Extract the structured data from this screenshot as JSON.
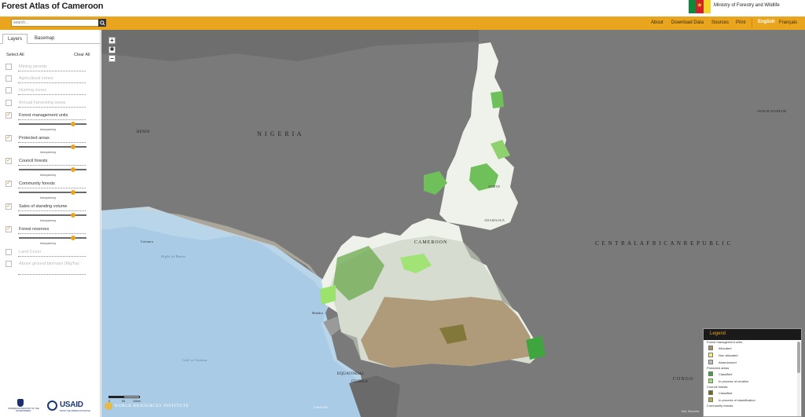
{
  "header": {
    "app_title": "Forest Atlas of Cameroon",
    "ministry": "Ministry of Forestry and Wildlife"
  },
  "navbar": {
    "search_placeholder": "search...",
    "links": [
      "About",
      "Download Data",
      "Sources",
      "Print"
    ],
    "lang_active": "English",
    "lang_other": "Français"
  },
  "sidebar": {
    "tabs": [
      "Layers",
      "Basemap"
    ],
    "select_all": "Select All",
    "clear_all": "Clear All",
    "transparency_label": "transparency",
    "layers": [
      {
        "label": "Mining permits",
        "checked": false
      },
      {
        "label": "Agricultural zones",
        "checked": false
      },
      {
        "label": "Hunting zones",
        "checked": false
      },
      {
        "label": "Annual harvesting areas",
        "checked": false
      },
      {
        "label": "Forest management units",
        "checked": true,
        "opacity": 0.82
      },
      {
        "label": "Protected areas",
        "checked": true,
        "opacity": 0.82
      },
      {
        "label": "Council forests",
        "checked": true,
        "opacity": 0.82
      },
      {
        "label": "Community forests",
        "checked": true,
        "opacity": 0.82
      },
      {
        "label": "Sales of standing volume",
        "checked": true,
        "opacity": 0.82
      },
      {
        "label": "Forest reserves",
        "checked": true,
        "opacity": 0.82
      },
      {
        "label": "Land Cover",
        "checked": false
      },
      {
        "label": "Above ground biomass (Mg/ha)",
        "checked": false
      }
    ],
    "logos": {
      "norway": "NORWEGIAN MINISTRY OF THE ENVIRONMENT",
      "usaid": "USAID",
      "usaid_sub": "FROM THE AMERICAN PEOPLE"
    }
  },
  "map": {
    "zoom_in": "+",
    "zoom_out": "−",
    "wri": "WORLD RESOURCES INSTITUTE",
    "scale_labels": [
      "0",
      "50",
      "100mi"
    ],
    "attribution": "Esri, DeLorme",
    "labels": [
      {
        "text": "N I G E R I A",
        "size": 8,
        "color": "#222"
      },
      {
        "text": "CAMEROON",
        "size": 6,
        "color": "#222"
      },
      {
        "text": "C E N T R A L   A F R I C A N   R E P U B L I C",
        "size": 7,
        "color": "#222"
      },
      {
        "text": "BENIN",
        "size": 5,
        "color": "#222"
      },
      {
        "text": "Bight of Benin",
        "size": 4.5,
        "color": "#5b7fa6"
      },
      {
        "text": "Gulf of Guinea",
        "size": 4.5,
        "color": "#5b7fa6"
      },
      {
        "text": "EQUATORIAL",
        "size": 5,
        "color": "#222"
      },
      {
        "text": "GUINEA",
        "size": 5,
        "color": "#222"
      },
      {
        "text": "NORTH",
        "size": 4,
        "color": "#444"
      },
      {
        "text": "ADAMAOUA",
        "size": 4,
        "color": "#444"
      },
      {
        "text": "CONGO",
        "size": 6,
        "color": "#222"
      },
      {
        "text": "JANUB DARFUR",
        "size": 4.5,
        "color": "#222"
      },
      {
        "text": "Libreville",
        "size": 4,
        "color": "#fff"
      },
      {
        "text": "Malabo",
        "size": 4,
        "color": "#222"
      },
      {
        "text": "Cotonou",
        "size": 4,
        "color": "#222"
      }
    ]
  },
  "legend": {
    "title": "Legend",
    "groups": [
      {
        "name": "Forest management units",
        "items": [
          {
            "label": "Allocated",
            "color": "#a88e6a"
          },
          {
            "label": "Non allocated",
            "color": "#f6f07a"
          },
          {
            "label": "Abandonned",
            "color": "#bdbdbd"
          }
        ]
      },
      {
        "name": "Protected areas",
        "items": [
          {
            "label": "Classified",
            "color": "#3fa63f"
          },
          {
            "label": "In process of creation",
            "color": "#9be36a"
          }
        ]
      },
      {
        "name": "Council forests",
        "items": [
          {
            "label": "Classified",
            "color": "#6f6a1f"
          },
          {
            "label": "In process of classification",
            "color": "#b6b03c"
          }
        ]
      },
      {
        "name": "Community forests",
        "items": []
      }
    ]
  }
}
